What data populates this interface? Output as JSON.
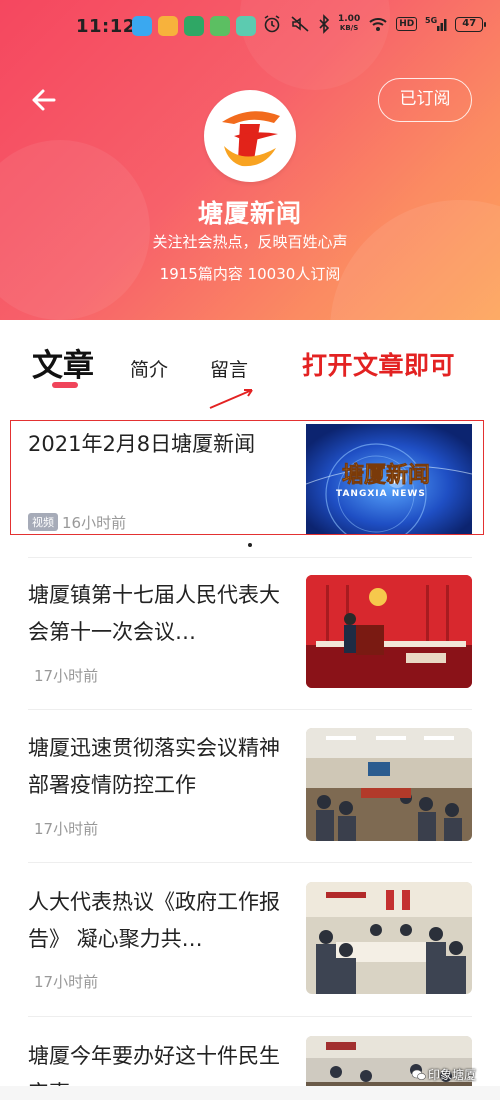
{
  "status_bar": {
    "time": "11:12",
    "net_speed_value": "1.00",
    "net_speed_unit": "KB/S",
    "hd_label": "HD",
    "signal_label": "5G",
    "battery": "47"
  },
  "header": {
    "subscribe_label": "已订阅",
    "channel_name": "塘厦新闻",
    "slogan": "关注社会热点，反映百姓心声",
    "stats": "1915篇内容 10030人订阅"
  },
  "tabs": {
    "articles": "文章",
    "intro": "简介",
    "comments": "留言"
  },
  "annotation_text": "打开文章即可",
  "articles": [
    {
      "title": "2021年2月8日塘厦新闻",
      "tag": "视频",
      "time": "16小时前",
      "thumb_caption_cn": "塘厦新闻",
      "thumb_caption_en": "TANGXIA NEWS"
    },
    {
      "title": "塘厦镇第十七届人民代表大会第十一次会议…",
      "time": "17小时前"
    },
    {
      "title": "塘厦迅速贯彻落实会议精神 部署疫情防控工作",
      "time": "17小时前"
    },
    {
      "title": "人大代表热议《政府工作报告》 凝心聚力共…",
      "time": "17小时前"
    },
    {
      "title": "塘厦今年要办好这十件民生实事",
      "time": ""
    }
  ],
  "watermark": "印象塘厦",
  "colors": {
    "accent": "#f0445a",
    "annotation": "#e32222",
    "header_start": "#f5475f",
    "header_end": "#fda45a"
  }
}
